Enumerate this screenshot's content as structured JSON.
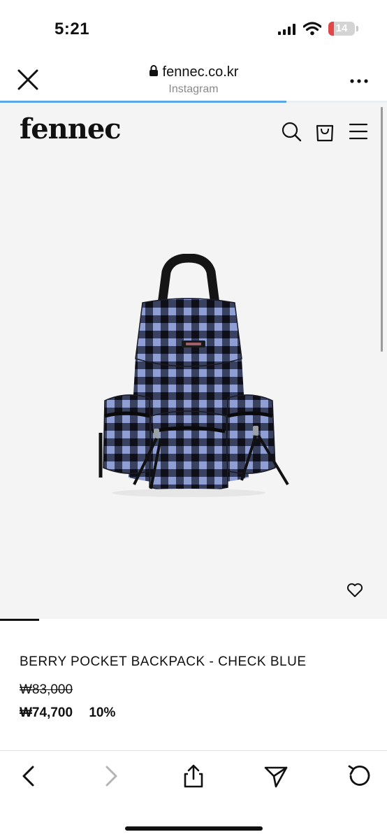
{
  "status_bar": {
    "time": "5:21",
    "battery_level": "14",
    "icons": [
      "cellular-signal-icon",
      "wifi-icon",
      "battery-icon"
    ],
    "battery_color": "#e04848"
  },
  "browser": {
    "url": "fennec.co.kr",
    "source": "Instagram",
    "load_progress": 0.74,
    "progress_color": "#5aa6e6",
    "icons": [
      "close-icon",
      "lock-icon",
      "more-icon"
    ]
  },
  "site": {
    "logo": "fennec",
    "header_icons": [
      "search-icon",
      "shopping-bag-icon",
      "menu-icon"
    ]
  },
  "product": {
    "image": "backpack-check-blue-photo",
    "name": "BERRY POCKET BACKPACK - CHECK BLUE",
    "original_price": "₩83,000",
    "sale_price": "₩74,700",
    "discount": "10%",
    "wishlist_icon": "heart-icon"
  },
  "toolbar": {
    "icons": [
      "back-icon",
      "forward-icon",
      "share-icon",
      "send-icon",
      "reload-icon"
    ]
  }
}
